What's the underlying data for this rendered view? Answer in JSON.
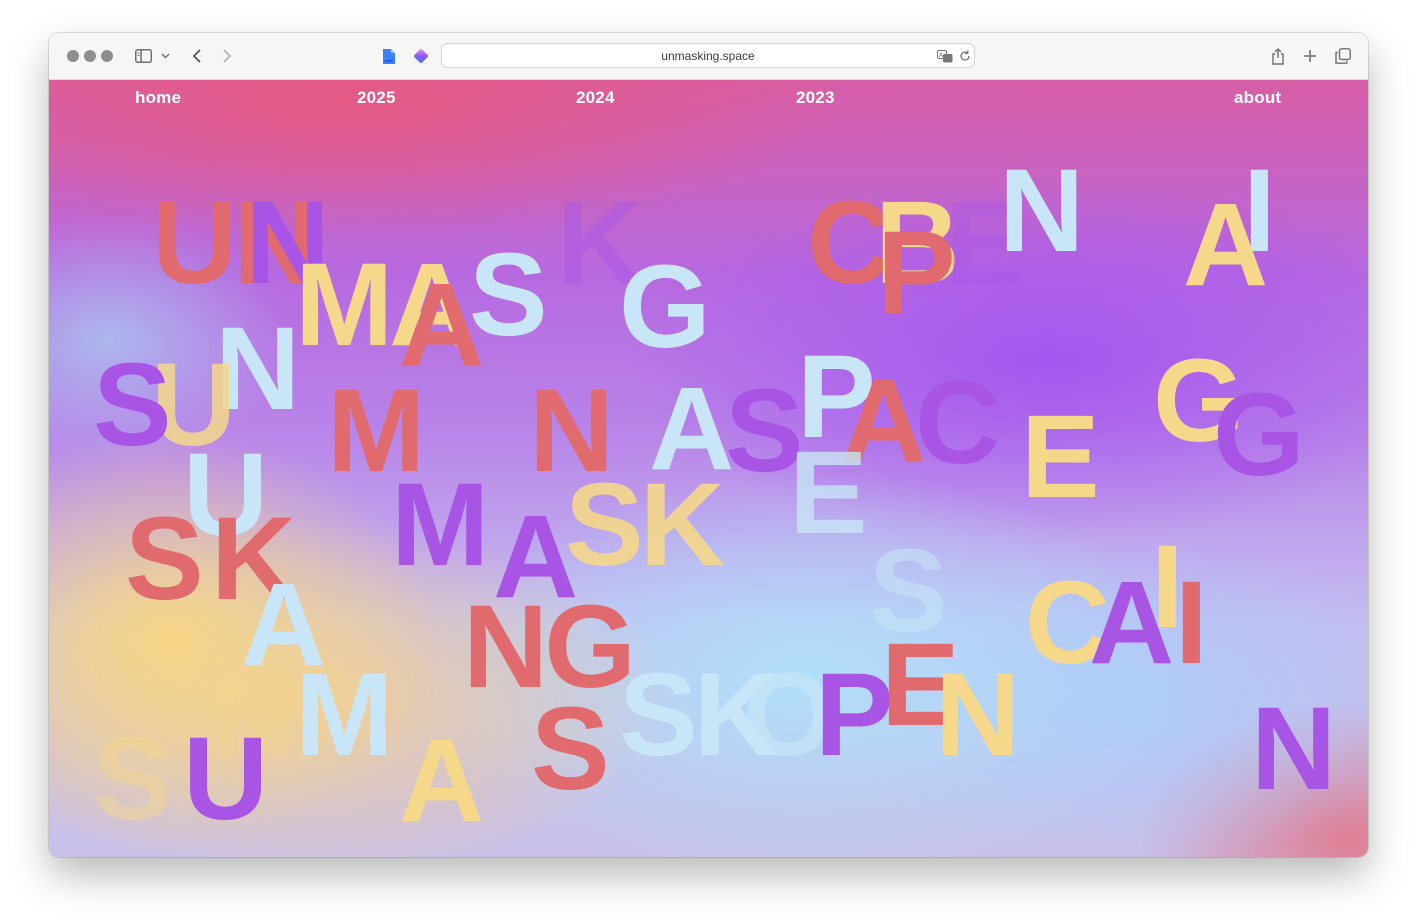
{
  "browser": {
    "url": "unmasking.space",
    "icons": [
      "window-controls",
      "sidebar-icon",
      "chevron-down-icon",
      "back-icon",
      "forward-icon",
      "document-icon",
      "extension-icon",
      "translate-icon",
      "reload-icon",
      "share-icon",
      "new-tab-icon",
      "tabs-overview-icon"
    ]
  },
  "nav": {
    "home": "home",
    "y2025": "2025",
    "y2024": "2024",
    "y2023": "2023",
    "about": "about"
  },
  "colors": {
    "red": "#e06a6e",
    "purple": "#a855e6",
    "yellow": "#f5d88a",
    "lightblue": "#c8e6f7"
  },
  "letters": [
    {
      "text": "UN",
      "color": "red"
    },
    {
      "text": "N",
      "color": "purple"
    },
    {
      "text": "K",
      "color": "purple"
    },
    {
      "text": "MA",
      "color": "yellow"
    },
    {
      "text": "A",
      "color": "red"
    },
    {
      "text": "S",
      "color": "lightblue"
    },
    {
      "text": "G",
      "color": "lightblue"
    },
    {
      "text": "C",
      "color": "red"
    },
    {
      "text": "B",
      "color": "yellow"
    },
    {
      "text": "P",
      "color": "red"
    },
    {
      "text": "E",
      "color": "purple"
    },
    {
      "text": "N",
      "color": "lightblue"
    },
    {
      "text": "I",
      "color": "purple"
    },
    {
      "text": "A",
      "color": "yellow"
    },
    {
      "text": "I",
      "color": "lightblue"
    },
    {
      "text": "N",
      "color": "lightblue"
    },
    {
      "text": "U",
      "color": "yellow"
    },
    {
      "text": "S",
      "color": "purple"
    },
    {
      "text": "M",
      "color": "red"
    },
    {
      "text": "N",
      "color": "red"
    },
    {
      "text": "A",
      "color": "lightblue"
    },
    {
      "text": "S",
      "color": "purple"
    },
    {
      "text": "P",
      "color": "lightblue"
    },
    {
      "text": "A",
      "color": "red"
    },
    {
      "text": "C",
      "color": "purple"
    },
    {
      "text": "E",
      "color": "yellow"
    },
    {
      "text": "G",
      "color": "yellow"
    },
    {
      "text": "G",
      "color": "purple"
    },
    {
      "text": "U",
      "color": "lightblue"
    },
    {
      "text": "E",
      "color": "lightblue"
    },
    {
      "text": "S",
      "color": "red"
    },
    {
      "text": "K",
      "color": "red"
    },
    {
      "text": "M",
      "color": "purple"
    },
    {
      "text": "A",
      "color": "purple"
    },
    {
      "text": "SK",
      "color": "yellow"
    },
    {
      "text": "A",
      "color": "lightblue"
    },
    {
      "text": "S",
      "color": "lightblue"
    },
    {
      "text": "C",
      "color": "yellow"
    },
    {
      "text": "A",
      "color": "purple"
    },
    {
      "text": "I",
      "color": "yellow"
    },
    {
      "text": "I",
      "color": "red"
    },
    {
      "text": "NG",
      "color": "red"
    },
    {
      "text": "N",
      "color": "yellow"
    },
    {
      "text": "M",
      "color": "lightblue"
    },
    {
      "text": "SK",
      "color": "lightblue"
    },
    {
      "text": "O",
      "color": "lightblue"
    },
    {
      "text": "P",
      "color": "purple"
    },
    {
      "text": "E",
      "color": "red"
    },
    {
      "text": "N",
      "color": "yellow"
    },
    {
      "text": "N",
      "color": "purple"
    },
    {
      "text": "S",
      "color": "yellow"
    },
    {
      "text": "U",
      "color": "purple"
    },
    {
      "text": "A",
      "color": "yellow"
    },
    {
      "text": "S",
      "color": "red"
    }
  ]
}
